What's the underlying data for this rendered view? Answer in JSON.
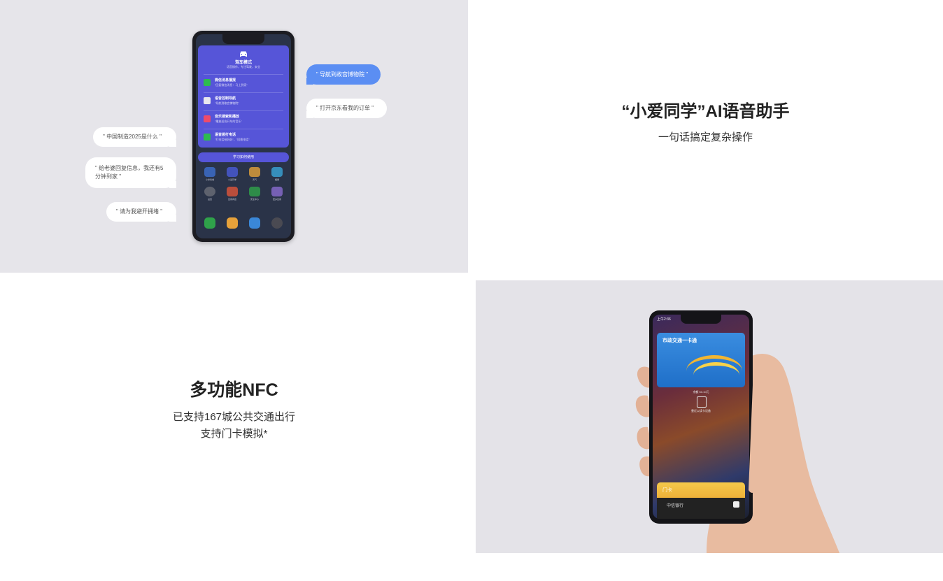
{
  "panel_voice": {
    "phone": {
      "mode_title": "驾车模式",
      "mode_subtitle": "语音操作，专注驾驶，安全",
      "items": [
        {
          "title": "微信消息播报",
          "desc": "\"回复微信消息：马上到家\"",
          "color": "#2dbb4f"
        },
        {
          "title": "语音控制导航",
          "desc": "\"导航到故宫博物院\"",
          "color": "#e8e8ee"
        },
        {
          "title": "音乐搜索和播放",
          "desc": "\"播放适合开车的音乐\"",
          "color": "#ee4b6a"
        },
        {
          "title": "语音拨打电话",
          "desc": "\"打电话给妈妈\"，\"回拨电话\"",
          "color": "#2dbb4f"
        }
      ],
      "learn_button": "学习如何使用",
      "app_labels": [
        "小米商城",
        "小爱同学",
        "天气",
        "相册",
        "设置",
        "应用商店",
        "安全中心",
        "更多应用"
      ]
    },
    "bubbles": [
      {
        "id": "navigate",
        "text": "\" 导航到故宫博物院 \"",
        "style": "blue"
      },
      {
        "id": "jd",
        "text": "\" 打开京东看我的订单 \"",
        "style": "white"
      },
      {
        "id": "china2025",
        "text": "\" 中国制造2025是什么 \"",
        "style": "white"
      },
      {
        "id": "wife",
        "text": "\" 给老婆回复信息，我还有5分钟到家 \"",
        "style": "white"
      },
      {
        "id": "avoid",
        "text": "\" 请为我避开拥堵 \"",
        "style": "white"
      }
    ]
  },
  "panel_ai": {
    "title": "“小爱同学”AI语音助手",
    "subtitle": "一句话搞定复杂操作"
  },
  "panel_nfc_text": {
    "title": "多功能NFC",
    "line1": "已支持167城公共交通出行",
    "line2": "支持门卡模拟*"
  },
  "panel_nfc_phone": {
    "time": "上午2:36",
    "transit_card": "市政交通一卡通",
    "balance": "余额 53.10元",
    "scan_hint": "靠近以读卡设备",
    "door_card": "门卡",
    "bank_card": "中信银行"
  },
  "colors": {
    "panel_grey": "#e6e5ea",
    "assistant_purple": "#5655d8",
    "bubble_blue": "#5b8ef3",
    "transit_blue": "#2a7fd6",
    "door_yellow": "#f0b83a"
  }
}
